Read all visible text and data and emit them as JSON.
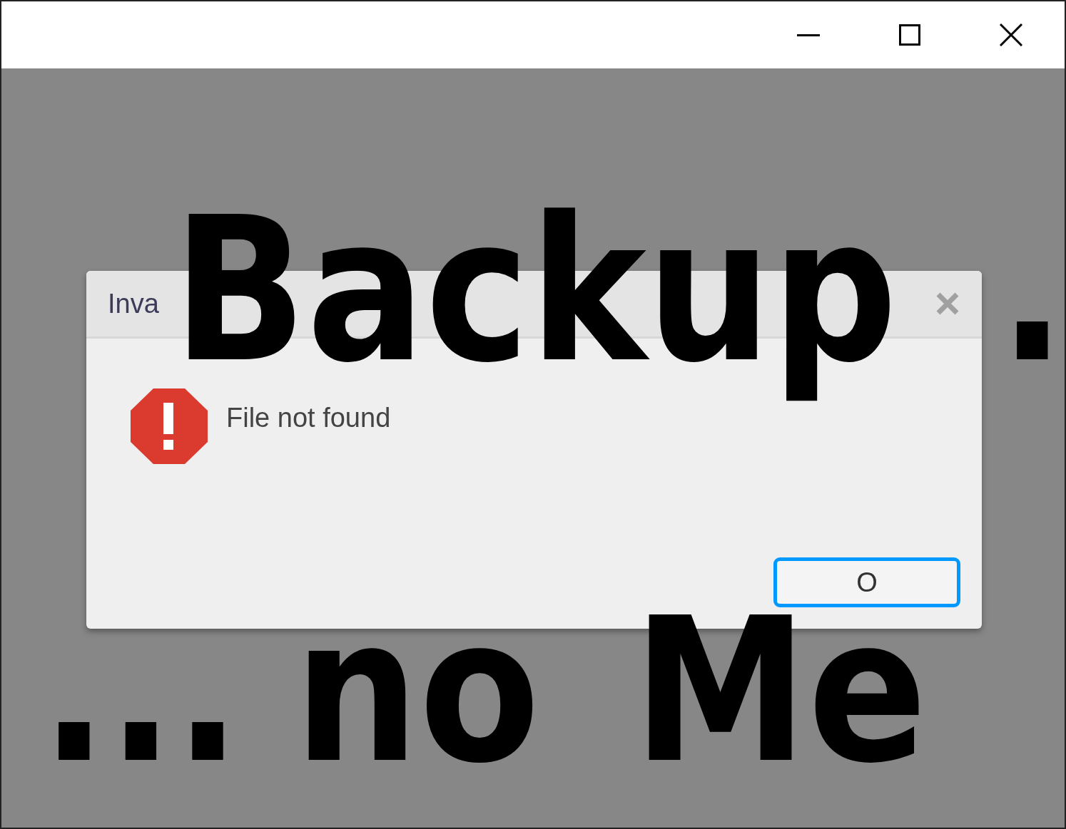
{
  "dialog": {
    "title": "Inva",
    "message": "File not found",
    "button": "O"
  },
  "caption": [
    {
      "words": [
        "Backup",
        "."
      ]
    },
    {
      "words": [
        "...",
        "no",
        "Me"
      ]
    }
  ]
}
